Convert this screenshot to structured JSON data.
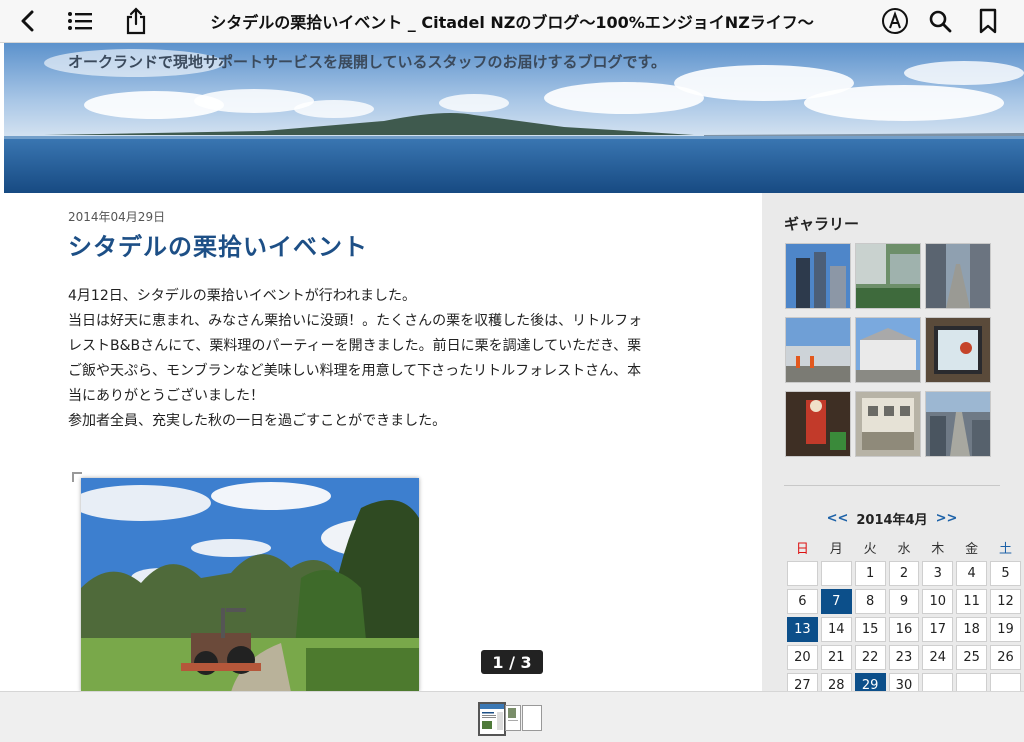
{
  "toolbar": {
    "title": "シタデルの栗拾いイベント _ Citadel NZのブログ〜100%エンジョイNZライフ〜",
    "icons": [
      "back-icon",
      "list-icon",
      "share-icon",
      "markup-icon",
      "search-icon",
      "bookmark-icon"
    ]
  },
  "banner": {
    "tagline": "オークランドで現地サポートサービスを展開しているスタッフのお届けするブログです。"
  },
  "post": {
    "date": "2014年04月29日",
    "title": "シタデルの栗拾いイベント",
    "paragraphs": [
      "4月12日、シタデルの栗拾いイベントが行われました。",
      "当日は好天に恵まれ、みなさん栗拾いに没頭！。たくさんの栗を収穫した後は、リトルフォ",
      "レストB&Bさんにて、栗料理のパーティーを開きました。前日に栗を調達していただき、栗",
      "ご飯や天ぷら、モンブランなど美味しい料理を用意して下さったリトルフォレストさん、本",
      "当にありがとうございました！",
      "参加者全員、充実した秋の一日を過ごすことができました。"
    ]
  },
  "page_indicator": "1 / 3",
  "sidebar": {
    "gallery_heading": "ギャラリー",
    "calendar": {
      "prev": "<<",
      "month_label": "2014年4月",
      "next": ">>",
      "weekdays": [
        "日",
        "月",
        "火",
        "水",
        "木",
        "金",
        "土"
      ],
      "weeks": [
        [
          "",
          "",
          "1",
          "2",
          "3",
          "4",
          "5"
        ],
        [
          "6",
          "7",
          "8",
          "9",
          "10",
          "11",
          "12"
        ],
        [
          "13",
          "14",
          "15",
          "16",
          "17",
          "18",
          "19"
        ],
        [
          "20",
          "21",
          "22",
          "23",
          "24",
          "25",
          "26"
        ],
        [
          "27",
          "28",
          "29",
          "30",
          "",
          "",
          ""
        ]
      ],
      "highlighted_days": [
        "7",
        "13",
        "29"
      ]
    }
  },
  "colors": {
    "title_blue": "#1d4f86",
    "calendar_highlight": "#0c4f8a",
    "sunday": "#d11111",
    "saturday": "#1d62a8"
  }
}
